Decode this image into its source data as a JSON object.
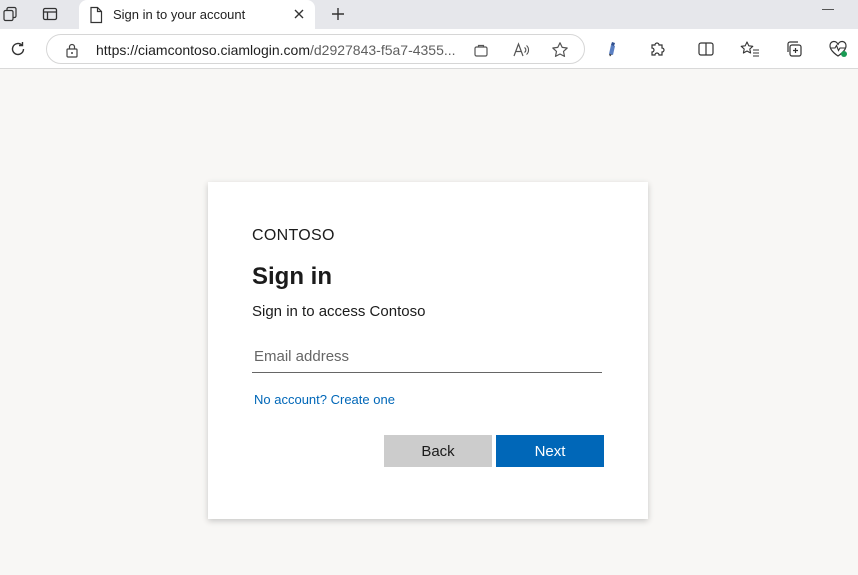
{
  "browser": {
    "tab": {
      "title": "Sign in to your account"
    },
    "address": {
      "url_main": "https://ciamcontoso.ciamlogin.com",
      "url_rest": "/d2927843-f5a7-4355..."
    }
  },
  "icons": {
    "workspaces": "workspaces-icon",
    "tab_actions": "tab-actions-icon",
    "page": "page-icon",
    "close": "close-icon",
    "new_tab": "plus-icon",
    "refresh": "refresh-icon",
    "lock": "lock-icon",
    "app_available": "app-available-icon",
    "read_aloud": "read-aloud-icon",
    "favorite": "star-icon",
    "extension_pen": "extension-pen-icon",
    "extensions": "puzzle-icon",
    "split_screen": "split-screen-icon",
    "favorites": "favorites-list-icon",
    "collections": "collections-icon",
    "browser_essentials": "heart-pulse-icon"
  },
  "colors": {
    "accent": "#0067b8",
    "page_bg": "#f8f7f5",
    "back_button": "#cccccc"
  },
  "login": {
    "brand": "CONTOSO",
    "heading": "Sign in",
    "subtitle": "Sign in to access Contoso",
    "email_placeholder": "Email address",
    "create_account_link": "No account? Create one",
    "back_label": "Back",
    "next_label": "Next"
  }
}
